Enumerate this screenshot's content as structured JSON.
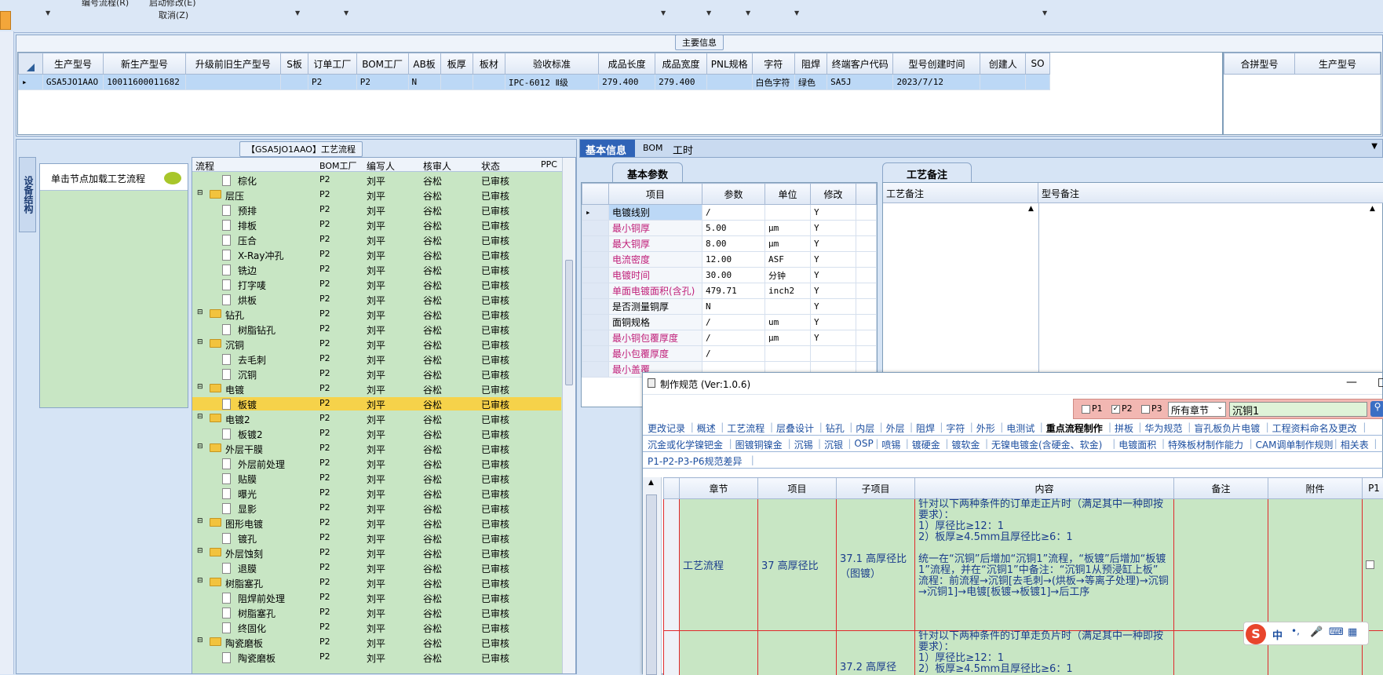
{
  "menu": {
    "item1": "编号流程(R)",
    "item2": "启动修改(E)",
    "item3": "取消(Z)"
  },
  "main_info": {
    "title": "主要信息",
    "columns": [
      "生产型号",
      "新生产型号",
      "升级前旧生产型号",
      "S板",
      "订单工厂",
      "BOM工厂",
      "AB板",
      "板厚",
      "板材",
      "验收标准",
      "成品长度",
      "成品宽度",
      "PNL规格",
      "字符",
      "阻焊",
      "终端客户代码",
      "型号创建时间",
      "创建人",
      "SO"
    ],
    "row": [
      "GSA5JO1AAO",
      "10011600011682",
      "",
      "",
      "P2",
      "P2",
      "N",
      "",
      "",
      "IPC-6012 Ⅱ级",
      "279.400",
      "279.400",
      "",
      "白色字符",
      "绿色",
      "SA5J",
      "2023/7/12",
      "",
      ""
    ],
    "side_columns": [
      "合拼型号",
      "生产型号"
    ]
  },
  "flow_panel": {
    "title": "【GSA5JO1AAO】工艺流程",
    "side_tab": "设备结构",
    "load_button": "单击节点加载工艺流程",
    "columns": [
      "流程",
      "BOM工厂",
      "编写人",
      "核审人",
      "状态",
      "PPC"
    ],
    "rows": [
      {
        "type": "leaf",
        "name": "棕化",
        "bom": "P2",
        "writer": "刘平",
        "reviewer": "谷松",
        "status": "已审核"
      },
      {
        "type": "folder",
        "name": "层压",
        "bom": "P2",
        "writer": "刘平",
        "reviewer": "谷松",
        "status": "已审核"
      },
      {
        "type": "leaf",
        "name": "预排",
        "bom": "P2",
        "writer": "刘平",
        "reviewer": "谷松",
        "status": "已审核"
      },
      {
        "type": "leaf",
        "name": "排板",
        "bom": "P2",
        "writer": "刘平",
        "reviewer": "谷松",
        "status": "已审核"
      },
      {
        "type": "leaf",
        "name": "压合",
        "bom": "P2",
        "writer": "刘平",
        "reviewer": "谷松",
        "status": "已审核"
      },
      {
        "type": "leaf",
        "name": "X-Ray冲孔",
        "bom": "P2",
        "writer": "刘平",
        "reviewer": "谷松",
        "status": "已审核"
      },
      {
        "type": "leaf",
        "name": "铣边",
        "bom": "P2",
        "writer": "刘平",
        "reviewer": "谷松",
        "status": "已审核"
      },
      {
        "type": "leaf",
        "name": "打字唛",
        "bom": "P2",
        "writer": "刘平",
        "reviewer": "谷松",
        "status": "已审核"
      },
      {
        "type": "leaf",
        "name": "烘板",
        "bom": "P2",
        "writer": "刘平",
        "reviewer": "谷松",
        "status": "已审核"
      },
      {
        "type": "folder",
        "name": "钻孔",
        "bom": "P2",
        "writer": "刘平",
        "reviewer": "谷松",
        "status": "已审核"
      },
      {
        "type": "leaf",
        "name": "树脂钻孔",
        "bom": "P2",
        "writer": "刘平",
        "reviewer": "谷松",
        "status": "已审核"
      },
      {
        "type": "folder",
        "name": "沉铜",
        "bom": "P2",
        "writer": "刘平",
        "reviewer": "谷松",
        "status": "已审核"
      },
      {
        "type": "leaf",
        "name": "去毛刺",
        "bom": "P2",
        "writer": "刘平",
        "reviewer": "谷松",
        "status": "已审核"
      },
      {
        "type": "leaf",
        "name": "沉铜",
        "bom": "P2",
        "writer": "刘平",
        "reviewer": "谷松",
        "status": "已审核"
      },
      {
        "type": "folder",
        "name": "电镀",
        "bom": "P2",
        "writer": "刘平",
        "reviewer": "谷松",
        "status": "已审核"
      },
      {
        "type": "leaf",
        "name": "板镀",
        "bom": "P2",
        "writer": "刘平",
        "reviewer": "谷松",
        "status": "已审核",
        "selected": true
      },
      {
        "type": "folder",
        "name": "电镀2",
        "bom": "P2",
        "writer": "刘平",
        "reviewer": "谷松",
        "status": "已审核"
      },
      {
        "type": "leaf",
        "name": "板镀2",
        "bom": "P2",
        "writer": "刘平",
        "reviewer": "谷松",
        "status": "已审核"
      },
      {
        "type": "folder",
        "name": "外层干膜",
        "bom": "P2",
        "writer": "刘平",
        "reviewer": "谷松",
        "status": "已审核"
      },
      {
        "type": "leaf",
        "name": "外层前处理",
        "bom": "P2",
        "writer": "刘平",
        "reviewer": "谷松",
        "status": "已审核"
      },
      {
        "type": "leaf",
        "name": "贴膜",
        "bom": "P2",
        "writer": "刘平",
        "reviewer": "谷松",
        "status": "已审核"
      },
      {
        "type": "leaf",
        "name": "曝光",
        "bom": "P2",
        "writer": "刘平",
        "reviewer": "谷松",
        "status": "已审核"
      },
      {
        "type": "leaf",
        "name": "显影",
        "bom": "P2",
        "writer": "刘平",
        "reviewer": "谷松",
        "status": "已审核"
      },
      {
        "type": "folder",
        "name": "图形电镀",
        "bom": "P2",
        "writer": "刘平",
        "reviewer": "谷松",
        "status": "已审核"
      },
      {
        "type": "leaf",
        "name": "镀孔",
        "bom": "P2",
        "writer": "刘平",
        "reviewer": "谷松",
        "status": "已审核"
      },
      {
        "type": "folder",
        "name": "外层蚀刻",
        "bom": "P2",
        "writer": "刘平",
        "reviewer": "谷松",
        "status": "已审核"
      },
      {
        "type": "leaf",
        "name": "退膜",
        "bom": "P2",
        "writer": "刘平",
        "reviewer": "谷松",
        "status": "已审核"
      },
      {
        "type": "folder",
        "name": "树脂塞孔",
        "bom": "P2",
        "writer": "刘平",
        "reviewer": "谷松",
        "status": "已审核"
      },
      {
        "type": "leaf",
        "name": "阻焊前处理",
        "bom": "P2",
        "writer": "刘平",
        "reviewer": "谷松",
        "status": "已审核"
      },
      {
        "type": "leaf",
        "name": "树脂塞孔",
        "bom": "P2",
        "writer": "刘平",
        "reviewer": "谷松",
        "status": "已审核"
      },
      {
        "type": "leaf",
        "name": "终固化",
        "bom": "P2",
        "writer": "刘平",
        "reviewer": "谷松",
        "status": "已审核"
      },
      {
        "type": "folder",
        "name": "陶瓷磨板",
        "bom": "P2",
        "writer": "刘平",
        "reviewer": "谷松",
        "status": "已审核"
      },
      {
        "type": "leaf",
        "name": "陶瓷磨板",
        "bom": "P2",
        "writer": "刘平",
        "reviewer": "谷松",
        "status": "已审核"
      }
    ]
  },
  "basic_tabs": [
    "基本信息",
    "BOM",
    "工时"
  ],
  "basic_params": {
    "title": "基本参数",
    "columns": [
      "项目",
      "参数",
      "单位",
      "修改"
    ],
    "rows": [
      {
        "item": "电镀线别",
        "value": "/",
        "unit": "",
        "mod": "Y",
        "pink": false
      },
      {
        "item": "最小铜厚",
        "value": "5.00",
        "unit": "μm",
        "mod": "Y",
        "pink": true
      },
      {
        "item": "最大铜厚",
        "value": "8.00",
        "unit": "μm",
        "mod": "Y",
        "pink": true
      },
      {
        "item": "电流密度",
        "value": "12.00",
        "unit": "ASF",
        "mod": "Y",
        "pink": true
      },
      {
        "item": "电镀时间",
        "value": "30.00",
        "unit": "分钟",
        "mod": "Y",
        "pink": true
      },
      {
        "item": "单面电镀面积(含孔)",
        "value": "479.71",
        "unit": "inch2",
        "mod": "Y",
        "pink": true
      },
      {
        "item": "是否测量铜厚",
        "value": "N",
        "unit": "",
        "mod": "Y",
        "pink": false
      },
      {
        "item": "面铜规格",
        "value": "/",
        "unit": "um",
        "mod": "Y",
        "pink": false
      },
      {
        "item": "最小铜包覆厚度",
        "value": "/",
        "unit": "μm",
        "mod": "Y",
        "pink": true
      },
      {
        "item": "最小包覆厚度",
        "value": "/",
        "unit": "",
        "mod": "",
        "pink": true
      },
      {
        "item": "最小盖覆",
        "value": "",
        "unit": "",
        "mod": "",
        "pink": true
      }
    ]
  },
  "process_notes": {
    "title": "工艺备注",
    "col1": "工艺备注",
    "col2": "型号备注"
  },
  "spec_window": {
    "title": "制作规范 (Ver:1.0.6)",
    "filter": {
      "p1": "P1",
      "p2": "P2",
      "p3": "P3",
      "chapter": "所有章节",
      "search": "沉铜1"
    },
    "tabs_row1": [
      "更改记录",
      "概述",
      "工艺流程",
      "层叠设计",
      "钻孔",
      "内层",
      "外层",
      "阻焊",
      "字符",
      "外形",
      "电测试",
      "重点流程制作",
      "拼板",
      "华为规范",
      "盲孔板负片电镀",
      "工程资料命名及更改"
    ],
    "tabs_row2": [
      "沉金或化学镍钯金",
      "图镀铜镍金",
      "沉锡",
      "沉银",
      "OSP",
      "喷锡",
      "镀硬金",
      "镀软金",
      "无镍电镀金(含硬金、软金)",
      "电镀面积",
      "特殊板材制作能力",
      "CAM调单制作规则",
      "相关表"
    ],
    "tabs_row3": [
      "P1-P2-P3-P6规范差异"
    ],
    "columns": [
      "章节",
      "项目",
      "子项目",
      "内容",
      "备注",
      "附件",
      "P1"
    ],
    "rows": [
      {
        "chapter": "工艺流程",
        "item": "37 高厚径比",
        "sub": "37.1 高厚径比（图镀）",
        "content": "针对以下两种条件的订单走正片时（满足其中一种即按要求）：\n1）厚径比≥12：1\n2）板厚≥4.5mm且厚径比≥6：1\n\n统一在“沉铜”后增加“沉铜1”流程，“板镀”后增加“板镀1”流程，并在“沉铜1”中备注：“沉铜1从预浸缸上板”\n流程：前流程→沉铜[去毛刺→(烘板→等离子处理)→沉铜→沉铜1]→电镀[板镀→板镀1]→后工序"
      },
      {
        "chapter": "",
        "item": "",
        "sub": "37.2 高厚径",
        "content": "针对以下两种条件的订单走负片时（满足其中一种即按要求）：\n1）厚径比≥12：1\n2）板厚≥4.5mm且厚径比≥6：1"
      }
    ]
  },
  "ime": {
    "label": "中"
  }
}
